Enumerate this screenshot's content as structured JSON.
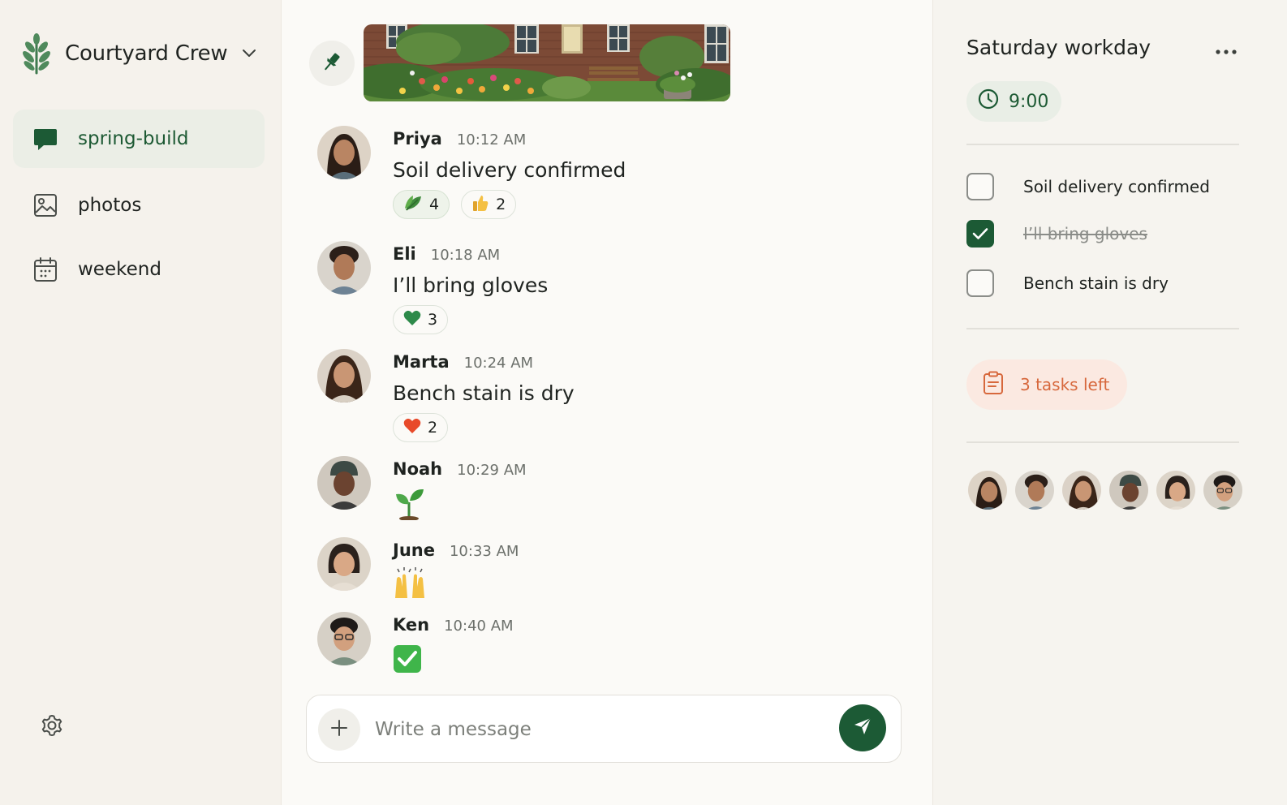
{
  "workspace": {
    "name": "Courtyard Crew",
    "logo_icon": "leaf-sprig-icon"
  },
  "sidebar": {
    "items": [
      {
        "label": "spring-build",
        "icon": "chat-bubble-icon",
        "active": true
      },
      {
        "label": "photos",
        "icon": "image-icon",
        "active": false
      },
      {
        "label": "weekend",
        "icon": "calendar-icon",
        "active": false
      }
    ],
    "settings_icon": "gear-icon"
  },
  "pinned": {
    "icon": "pin-icon",
    "image": "courtyard-garden-with-bench-photo"
  },
  "messages": [
    {
      "author": "Priya",
      "time": "10:12 AM",
      "text": "Soil delivery confirmed",
      "reactions": [
        {
          "emoji": "leaf",
          "count": "4"
        },
        {
          "emoji": "thumbs-up",
          "count": "2"
        }
      ]
    },
    {
      "author": "Eli",
      "time": "10:18 AM",
      "text": "I’ll bring gloves",
      "reactions": [
        {
          "emoji": "green-heart",
          "count": "3"
        }
      ]
    },
    {
      "author": "Marta",
      "time": "10:24 AM",
      "text": "Bench stain is dry",
      "reactions": [
        {
          "emoji": "red-heart",
          "count": "2"
        }
      ]
    },
    {
      "author": "Noah",
      "time": "10:29 AM",
      "emoji": "seedling"
    },
    {
      "author": "June",
      "time": "10:33 AM",
      "emoji": "raising-hands"
    },
    {
      "author": "Ken",
      "time": "10:40 AM",
      "emoji": "check-mark-button"
    }
  ],
  "composer": {
    "placeholder": "Write a message",
    "add_icon": "plus-icon",
    "send_icon": "send-icon"
  },
  "panel": {
    "title": "Saturday workday",
    "time": "9:00",
    "tasks": [
      {
        "label": "Soil delivery confirmed",
        "done": false
      },
      {
        "label": "I’ll bring gloves",
        "done": true
      },
      {
        "label": "Bench stain is dry",
        "done": false
      }
    ],
    "tasks_left": "3 tasks left",
    "members": [
      "Priya",
      "Eli",
      "Marta",
      "Noah",
      "June",
      "Ken"
    ]
  },
  "colors": {
    "accent_green": "#1c5a35",
    "accent_orange": "#d7683c",
    "background": "#f6f4ef"
  }
}
